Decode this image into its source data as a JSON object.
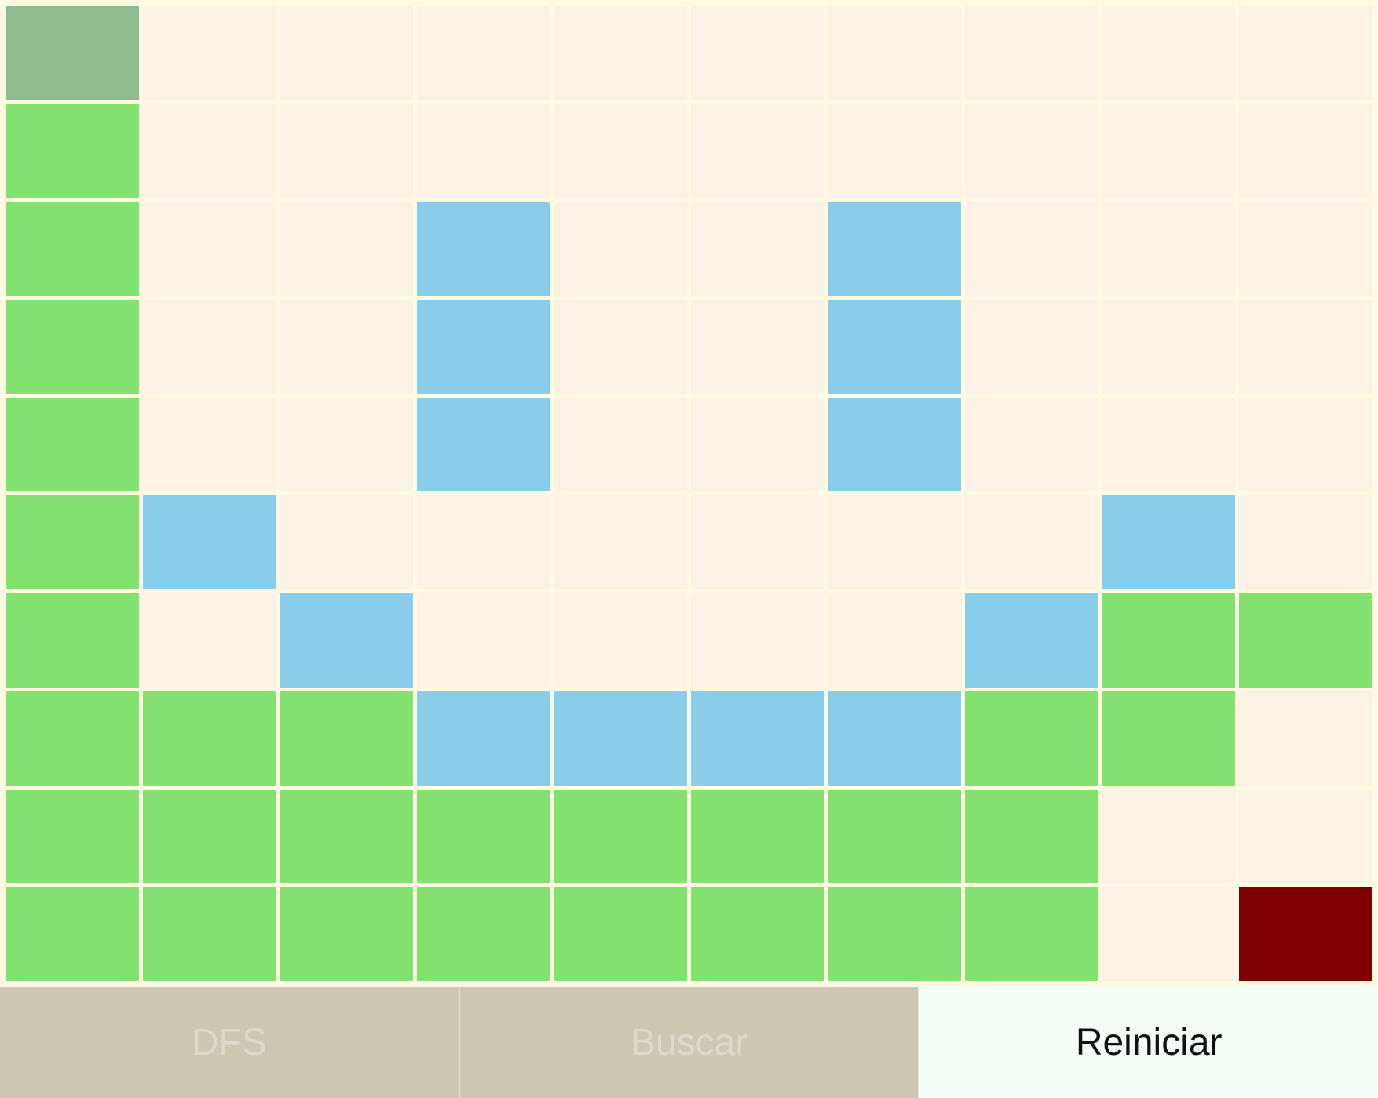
{
  "grid": {
    "rows": 10,
    "cols": 10,
    "legend": {
      "E": "#fbf1e4",
      "S": "#8fbc8f",
      "P": "#82e270",
      "W": "#88cdea",
      "G": "#7f0000"
    },
    "cells": [
      "SEEEEEEEEE",
      "PEEEEEEEEE",
      "PEEWEEWEEE",
      "PEEWEEWEEE",
      "PEEWEEWEEE",
      "PWEEEEEEWE",
      "PEWEEEEWPP",
      "PPPWWWWPPE",
      "PPPPPPPPEE",
      "PPPPPPPPEG"
    ]
  },
  "toolbar": {
    "buttons": [
      {
        "id": "dfs",
        "label": "DFS",
        "state": "disabled"
      },
      {
        "id": "buscar",
        "label": "Buscar",
        "state": "disabled"
      },
      {
        "id": "reiniciar",
        "label": "Reiniciar",
        "state": "active"
      }
    ]
  }
}
